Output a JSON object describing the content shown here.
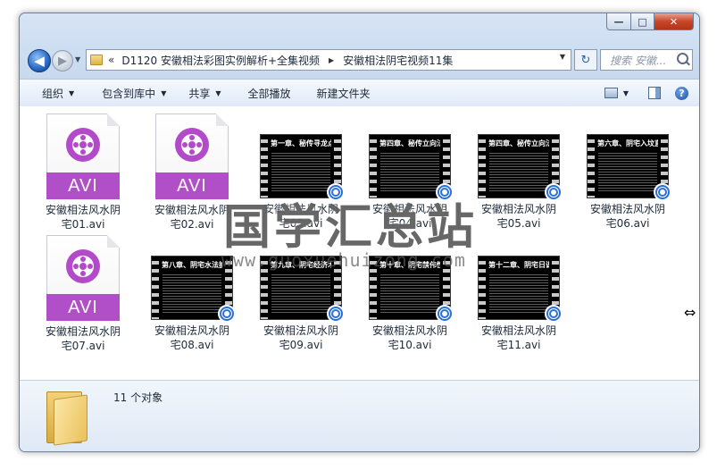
{
  "window": {
    "controls": {
      "minimize": "—",
      "maximize": "□",
      "close": "✕"
    }
  },
  "nav": {
    "back": "◀",
    "forward": "▶",
    "recent": "▼"
  },
  "address": {
    "prefix": "«",
    "crumbs": [
      "D1120 安徽相法彩图实例解析+全集视频",
      "安徽相法阴宅视频11集"
    ],
    "separator": "▶",
    "dropdown": "▼",
    "refresh": "↻"
  },
  "search": {
    "placeholder": "搜索 安徽..."
  },
  "toolbar": {
    "organize": "组织",
    "include_library": "包含到库中",
    "share": "共享",
    "play_all": "全部播放",
    "new_folder": "新建文件夹",
    "caret": "▼",
    "help": "?"
  },
  "files": [
    {
      "name": "安徽相法风水阴宅01.avi",
      "type": "avi",
      "tag": "AVI"
    },
    {
      "name": "安徽相法风水阴宅02.avi",
      "type": "avi",
      "tag": "AVI"
    },
    {
      "name": "安徽相法风水阴宅03.avi",
      "type": "video",
      "heading": "第一章、秘传寻龙点穴之"
    },
    {
      "name": "安徽相法风水阴宅04.avi",
      "type": "video",
      "heading": "第四章、秘传立向法诀"
    },
    {
      "name": "安徽相法风水阴宅05.avi",
      "type": "video",
      "heading": "第四章、秘传立向法诀"
    },
    {
      "name": "安徽相法风水阴宅06.avi",
      "type": "video",
      "heading": "第六章、阴宅入坟直断"
    },
    {
      "name": "安徽相法风水阴宅07.avi",
      "type": "avi",
      "tag": "AVI"
    },
    {
      "name": "安徽相法风水阴宅08.avi",
      "type": "video",
      "heading": "第八章、阴宅水法扩解"
    },
    {
      "name": "安徽相法风水阴宅09.avi",
      "type": "video",
      "heading": "第九章、阴宅经济术解"
    },
    {
      "name": "安徽相法风水阴宅10.avi",
      "type": "video",
      "heading": "第十章、阴宅禁伟性事"
    },
    {
      "name": "安徽相法风水阴宅11.avi",
      "type": "video",
      "heading": "第十二章、阴宅日课的选"
    }
  ],
  "status": {
    "count": "11 个对象"
  },
  "watermark": {
    "text": "国学汇总站",
    "url": "www.guoxuehuizong.com"
  }
}
